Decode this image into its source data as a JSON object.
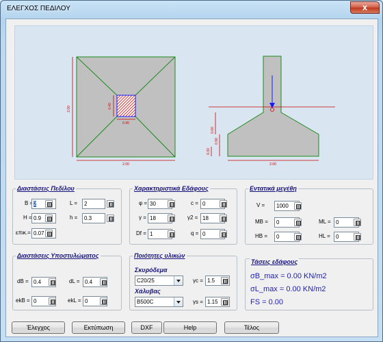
{
  "window": {
    "title": "ΕΛΕΓΧΟΣ ΠΕΔΙΛΟΥ",
    "close_glyph": "x"
  },
  "drawing": {
    "plan_width_label": "2.00",
    "plan_height_label": "2.00",
    "column_x_label": "0.40",
    "column_y_label": "0.40",
    "section_width_label": "2.00",
    "section_h_label": "0.90",
    "section_h2_label": "0.60",
    "section_cover_label": "0.30",
    "colors": {
      "outline": "#1a8a1a",
      "dims": "#cc0000",
      "load": "#1a1aff",
      "fill": "#c0c0c0"
    }
  },
  "footing_dims": {
    "title": "Διαστάσεις Πεδίλου",
    "B_label": "B =",
    "B_value": "2",
    "L_label": "L =",
    "L_value": "2",
    "H_label": "H =",
    "H_value": "0.9",
    "h_label": "h =",
    "h_value": "0.3",
    "cover_label": "επικ.=",
    "cover_value": "0.07"
  },
  "soil": {
    "title": "Χαρακτηριστικά Εδάφους",
    "phi_label": "φ =",
    "phi_value": "30",
    "c_label": "c =",
    "c_value": "0",
    "gamma_label": "γ =",
    "gamma_value": "18",
    "gamma2_label": "γ2 =",
    "gamma2_value": "18",
    "Df_label": "Df =",
    "Df_value": "1",
    "q_label": "q =",
    "q_value": "0"
  },
  "loads": {
    "title": "Εντατικά μεγέθη",
    "V_label": "V =",
    "V_value": "1000",
    "MB_label": "MB =",
    "MB_value": "0",
    "ML_label": "ML =",
    "ML_value": "0",
    "HB_label": "HB =",
    "HB_value": "0",
    "HL_label": "HL =",
    "HL_value": "0"
  },
  "column_dims": {
    "title": "Διαστάσεις Υποστυλώματος",
    "dB_label": "dB =",
    "dB_value": "0.4",
    "dL_label": "dL =",
    "dL_value": "0.4",
    "ekB_label": "ekB =",
    "ekB_value": "0",
    "ekL_label": "ekL =",
    "ekL_value": "0"
  },
  "materials": {
    "title": "Ποιότητες υλικών",
    "concrete_heading": "Σκυρόδεμα",
    "concrete_value": "C20/25",
    "gc_label": "γc =",
    "gc_value": "1.5",
    "steel_heading": "Χάλυβας",
    "steel_value": "B500C",
    "gs_label": "γs =",
    "gs_value": "1.15"
  },
  "stresses": {
    "title": "Τάσεις εδάφους",
    "sB_max": "σB_max = 0.00 KN/m2",
    "sL_max": "σL_max = 0.00 KN/m2",
    "fs": "FS = 0.00"
  },
  "buttons": {
    "check": "Έλεγχος",
    "print": "Εκτύπωση",
    "dxf": "DXF",
    "help": "Help",
    "exit": "Τέλος"
  }
}
